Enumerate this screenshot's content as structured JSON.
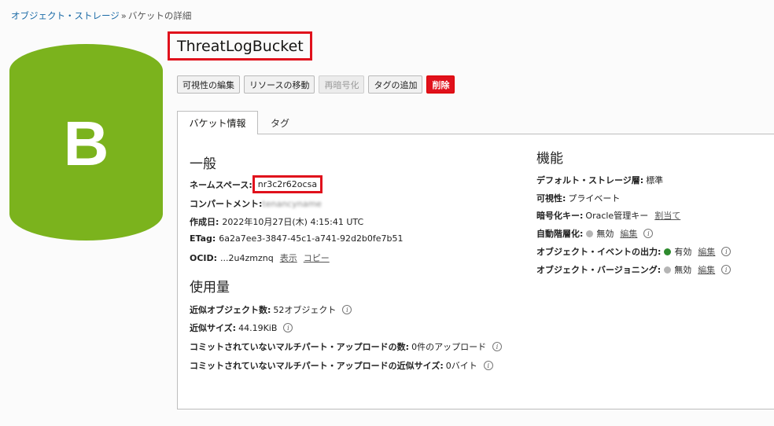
{
  "breadcrumb": {
    "parent": "オブジェクト・ストレージ",
    "separator": "»",
    "current": "バケットの詳細"
  },
  "bucket_icon": {
    "letter": "B",
    "color": "#7bb31d"
  },
  "title": "ThreatLogBucket",
  "actions": {
    "edit_visibility": "可視性の編集",
    "move_resource": "リソースの移動",
    "reencrypt": "再暗号化",
    "add_tag": "タグの追加",
    "delete": "削除"
  },
  "tabs": {
    "bucket_info": "バケット情報",
    "tags": "タグ"
  },
  "general": {
    "title": "一般",
    "namespace_label": "ネームスペース:",
    "namespace_value": "nr3c2r62ocsa",
    "compartment_label": "コンパートメント:",
    "compartment_value": "tenancyname",
    "created_label": "作成日:",
    "created_value": "2022年10月27日(木) 4:15:41 UTC",
    "etag_label": "ETag:",
    "etag_value": "6a2a7ee3-3847-45c1-a741-92d2b0fe7b51",
    "ocid_label": "OCID:",
    "ocid_value": "...2u4zmznq",
    "ocid_show": "表示",
    "ocid_copy": "コピー"
  },
  "usage": {
    "title": "使用量",
    "object_count_label": "近似オブジェクト数:",
    "object_count_value": "52オブジェクト",
    "size_label": "近似サイズ:",
    "size_value": "44.19KiB",
    "multipart_count_label": "コミットされていないマルチパート・アップロードの数:",
    "multipart_count_value": "0件のアップロード",
    "multipart_size_label": "コミットされていないマルチパート・アップロードの近似サイズ:",
    "multipart_size_value": "0バイト"
  },
  "features": {
    "title": "機能",
    "storage_tier_label": "デフォルト・ストレージ層:",
    "storage_tier_value": "標準",
    "visibility_label": "可視性:",
    "visibility_value": "プライベート",
    "encryption_label": "暗号化キー:",
    "encryption_value": "Oracle管理キー",
    "encryption_assign": "割当て",
    "auto_tiering_label": "自動階層化:",
    "auto_tiering_value": "無効",
    "auto_tiering_edit": "編集",
    "events_label": "オブジェクト・イベントの出力:",
    "events_value": "有効",
    "events_edit": "編集",
    "versioning_label": "オブジェクト・バージョニング:",
    "versioning_value": "無効",
    "versioning_edit": "編集"
  },
  "colors": {
    "enabled": "#2e8b2e",
    "disabled": "#b5b5b5",
    "highlight": "#e0111c"
  }
}
